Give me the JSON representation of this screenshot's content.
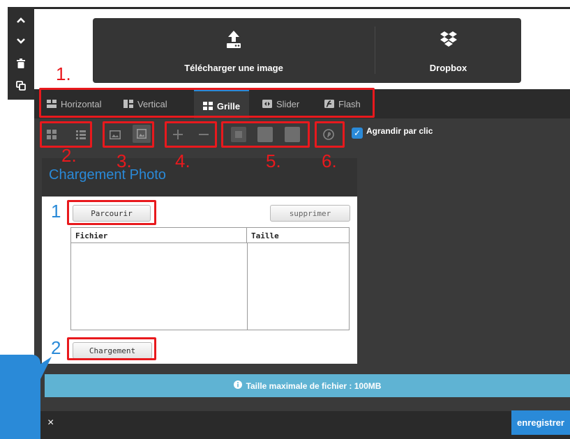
{
  "left_toolbar": {
    "icons": [
      "chevron-up-icon",
      "chevron-down-icon",
      "trash-icon",
      "duplicate-icon"
    ]
  },
  "upload_panel": {
    "upload_label": "Télécharger une image",
    "dropbox_label": "Dropbox"
  },
  "annotations": {
    "n1": "1.",
    "n2": "2.",
    "n3": "3.",
    "n4": "4.",
    "n5": "5.",
    "n6": "6."
  },
  "tabs": [
    {
      "label": "Horizontal",
      "icon": "horizontal-layout-icon",
      "active": false
    },
    {
      "label": "Vertical",
      "icon": "vertical-layout-icon",
      "active": false
    },
    {
      "label": "Grille",
      "icon": "grid-icon",
      "active": true
    },
    {
      "label": "Slider",
      "icon": "slider-icon",
      "active": false
    },
    {
      "label": "Flash",
      "icon": "flash-icon",
      "active": false
    }
  ],
  "toolbar": {
    "zoom_label": "Agrandir par clic",
    "zoom_checked": true
  },
  "uploader": {
    "title": "Chargement Photo",
    "step1": "1",
    "step2": "2",
    "browse_label": "Parcourir",
    "delete_label": "supprimer",
    "upload_label": "Chargement",
    "col_file": "Fichier",
    "col_size": "Taille"
  },
  "info": {
    "text": "Taille maximale de fichier : 100MB"
  },
  "footer": {
    "close": "×",
    "save": "enregistrer"
  },
  "colors": {
    "accent": "#2a8ad8",
    "annotation": "#e8191d",
    "info_bar": "#5fb3d3",
    "panel": "#353535"
  }
}
